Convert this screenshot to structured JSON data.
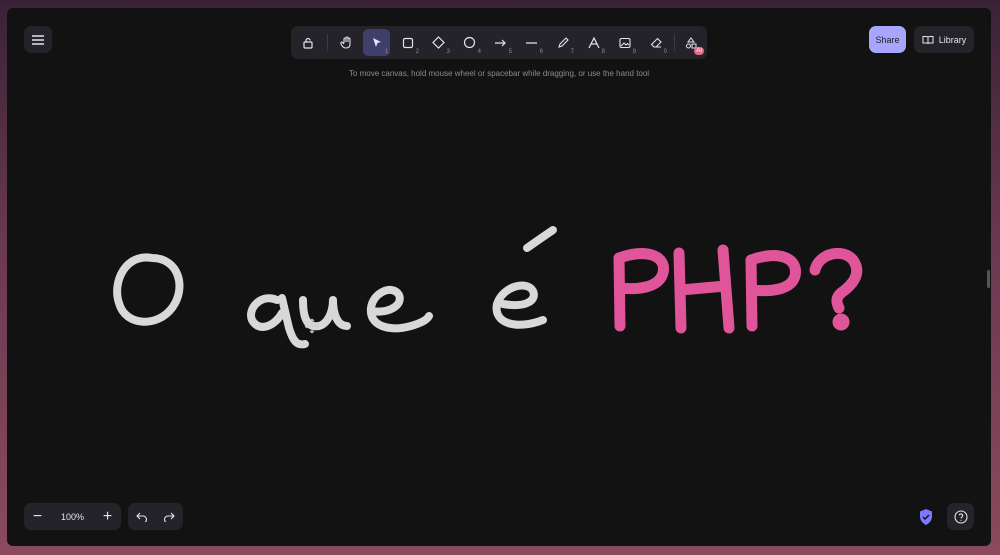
{
  "toolbar": {
    "tools": [
      {
        "name": "lock",
        "key": ""
      },
      {
        "name": "hand",
        "key": ""
      },
      {
        "name": "selection",
        "key": "1"
      },
      {
        "name": "rectangle",
        "key": "2"
      },
      {
        "name": "diamond",
        "key": "3"
      },
      {
        "name": "ellipse",
        "key": "4"
      },
      {
        "name": "arrow",
        "key": "5"
      },
      {
        "name": "line",
        "key": "6"
      },
      {
        "name": "draw",
        "key": "7"
      },
      {
        "name": "text",
        "key": "8"
      },
      {
        "name": "image",
        "key": "9"
      },
      {
        "name": "eraser",
        "key": "0"
      },
      {
        "name": "more-tools",
        "badge": "AI"
      }
    ],
    "active_tool": "selection"
  },
  "hint": "To move canvas, hold mouse wheel or spacebar while dragging, or use the hand tool",
  "header": {
    "share_label": "Share",
    "library_label": "Library"
  },
  "canvas": {
    "text_white": "O que é",
    "text_pink": "PHP?",
    "colors": {
      "white_stroke": "#d8d8d8",
      "pink_stroke": "#e0559a"
    }
  },
  "footer": {
    "zoom_value": "100%",
    "zoom_out": "−",
    "zoom_in": "+"
  },
  "colors": {
    "accent": "#a8a5ff",
    "active_tool_bg": "#403e6a",
    "background": "#121212"
  }
}
